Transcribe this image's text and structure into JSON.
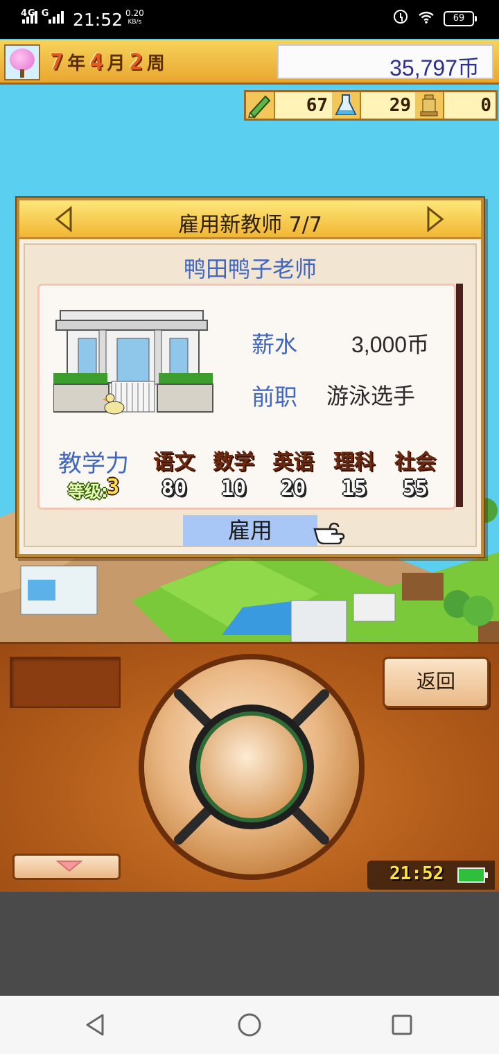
{
  "status_bar": {
    "network": "4G",
    "network2": "G",
    "time": "21:52",
    "speed_value": "0.20",
    "speed_unit": "KB/s",
    "battery": "69",
    "icons": [
      "signal-icon",
      "alarm-icon",
      "wifi-icon",
      "battery-icon"
    ]
  },
  "header": {
    "year": "7",
    "year_label": "年",
    "month": "4",
    "month_label": "月",
    "week": "2",
    "week_label": "周",
    "money": "35,797币"
  },
  "resources": [
    {
      "icon": "pencil-icon",
      "value": "67"
    },
    {
      "icon": "flask-icon",
      "value": "29"
    },
    {
      "icon": "trophy-icon",
      "value": "0"
    }
  ],
  "dialog": {
    "title": "雇用新教师 7/7",
    "teacher_name": "鸭田鸭子老师",
    "salary_label": "薪水",
    "salary_value": "3,000币",
    "former_job_label": "前职",
    "former_job_value": "游泳选手",
    "teaching_label": "教学力",
    "level_label": "等级:",
    "level_value": "3",
    "subjects": [
      {
        "name": "语文",
        "score": "80"
      },
      {
        "name": "数学",
        "score": "10"
      },
      {
        "name": "英语",
        "score": "20"
      },
      {
        "name": "理科",
        "score": "15"
      },
      {
        "name": "社会",
        "score": "55"
      }
    ],
    "hire_label": "雇用"
  },
  "controller": {
    "back_label": "返回",
    "clock": "21:52"
  },
  "colors": {
    "accent_blue": "#3f66c1",
    "hire_button": "#a9c7f6",
    "controller_wood": "#b05a1a"
  }
}
